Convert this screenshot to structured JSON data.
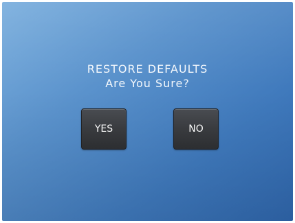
{
  "dialog": {
    "title": "RESTORE DEFAULTS",
    "subtitle": "Are You Sure?",
    "yes_label": "YES",
    "no_label": "NO"
  },
  "colors": {
    "background_light": "#7db0de",
    "background_dark": "#2f66ac",
    "button": "#3a3c40",
    "text": "#f4f8fc"
  }
}
